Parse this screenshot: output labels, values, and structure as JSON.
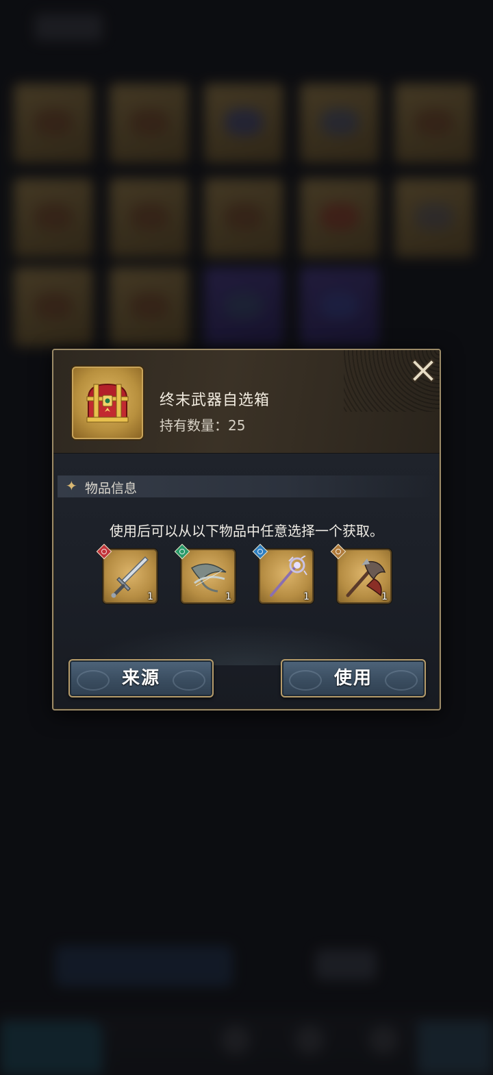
{
  "dialog": {
    "item_name": "终末武器自选箱",
    "count_text": "持有数量：25",
    "section_title": "物品信息",
    "description": "使用后可以从以下物品中任意选择一个获取。",
    "rewards": [
      {
        "icon": "sword-icon",
        "quantity": "1",
        "element_color": "#c0343a"
      },
      {
        "icon": "bow-icon",
        "quantity": "1",
        "element_color": "#2a9a6a"
      },
      {
        "icon": "staff-icon",
        "quantity": "1",
        "element_color": "#2f7fc0"
      },
      {
        "icon": "axe-icon",
        "quantity": "1",
        "element_color": "#b07a3a"
      }
    ],
    "source_button_label": "来源",
    "use_button_label": "使用"
  },
  "colors": {
    "dialog_border": "#9c8b68",
    "button_fill": "#3a4d60",
    "slot_gold": "#b78e44"
  }
}
